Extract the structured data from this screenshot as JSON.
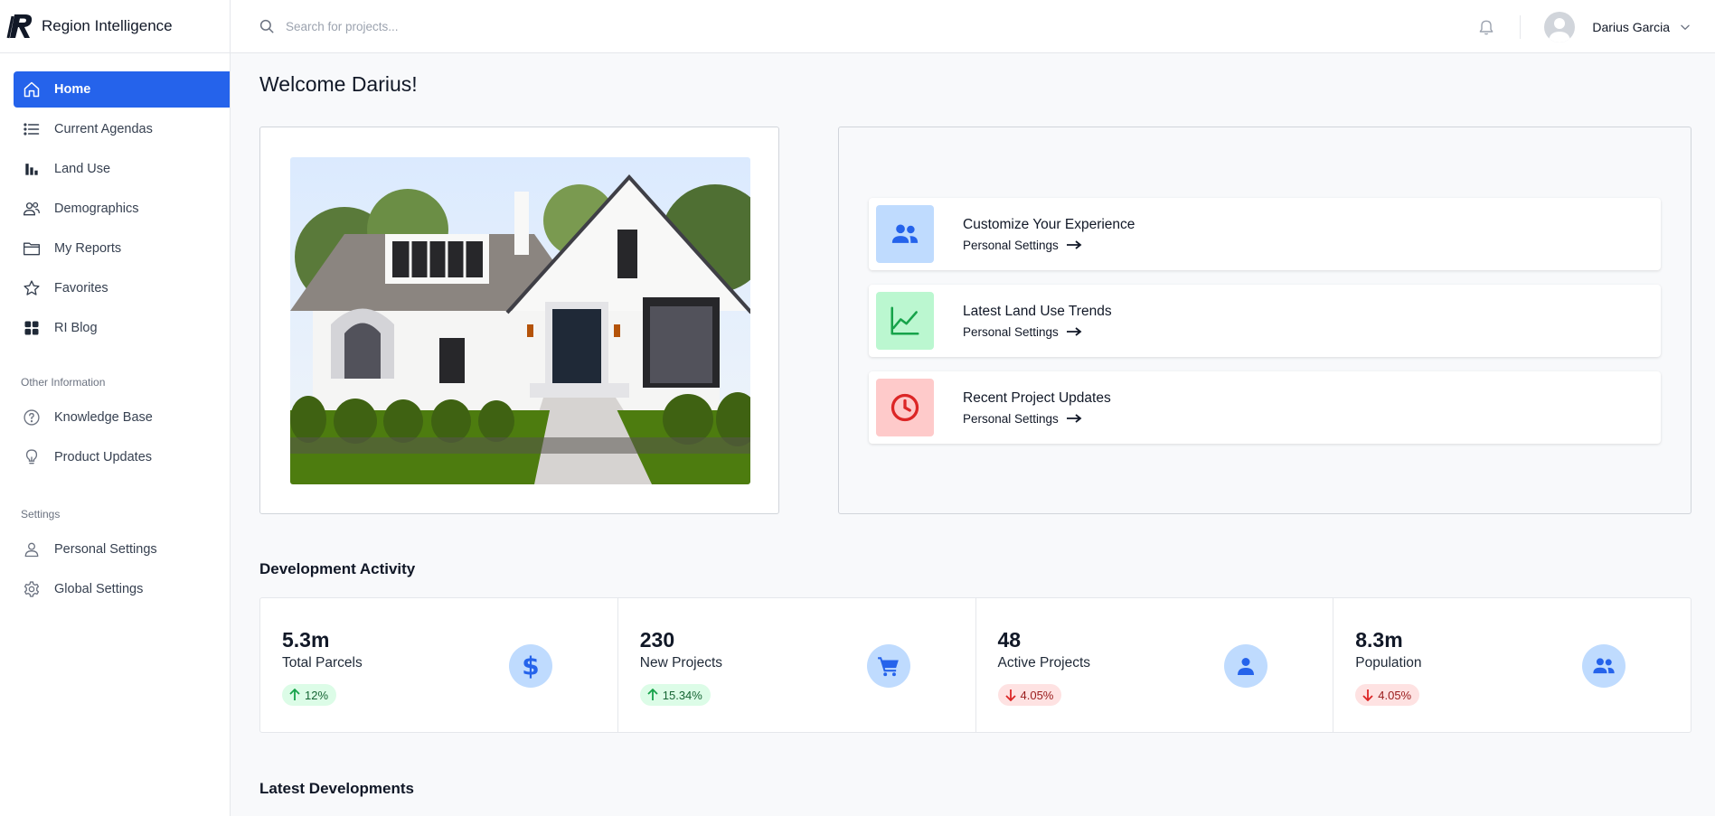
{
  "brand": {
    "name": "Region Intelligence"
  },
  "nav": {
    "items": [
      {
        "label": "Home",
        "icon": "home-icon",
        "active": true
      },
      {
        "label": "Current Agendas",
        "icon": "list-icon"
      },
      {
        "label": "Land Use",
        "icon": "bar-chart-icon"
      },
      {
        "label": "Demographics",
        "icon": "users-icon"
      },
      {
        "label": "My Reports",
        "icon": "folder-icon"
      },
      {
        "label": "Favorites",
        "icon": "star-icon"
      },
      {
        "label": "RI Blog",
        "icon": "grid-icon"
      }
    ],
    "other_label": "Other Information",
    "other_items": [
      {
        "label": "Knowledge Base",
        "icon": "help-circle-icon"
      },
      {
        "label": "Product Updates",
        "icon": "lightbulb-icon"
      }
    ],
    "settings_label": "Settings",
    "settings_items": [
      {
        "label": "Personal Settings",
        "icon": "user-icon"
      },
      {
        "label": "Global Settings",
        "icon": "gear-icon"
      }
    ]
  },
  "search": {
    "placeholder": "Search for projects..."
  },
  "user": {
    "name": "Darius Garcia"
  },
  "welcome": "Welcome Darius!",
  "actions": [
    {
      "title": "Customize Your Experience",
      "link": "Personal Settings",
      "icon": "users-icon",
      "bg": "#bfdbfe",
      "color": "#2563eb"
    },
    {
      "title": "Latest Land Use Trends",
      "link": "Personal Settings",
      "icon": "trend-chart-icon",
      "bg": "#bbf7d0",
      "color": "#16a34a"
    },
    {
      "title": "Recent Project Updates",
      "link": "Personal Settings",
      "icon": "clock-icon",
      "bg": "#fecaca",
      "color": "#dc2626"
    }
  ],
  "development_title": "Development Activity",
  "stats": [
    {
      "value": "5.3m",
      "label": "Total Parcels",
      "change": "12%",
      "direction": "up",
      "icon": "dollar-icon"
    },
    {
      "value": "230",
      "label": "New Projects",
      "change": "15.34%",
      "direction": "up",
      "icon": "cart-icon"
    },
    {
      "value": "48",
      "label": "Active Projects",
      "change": "4.05%",
      "direction": "down",
      "icon": "person-icon"
    },
    {
      "value": "8.3m",
      "label": "Population",
      "change": "4.05%",
      "direction": "down",
      "icon": "group-icon"
    }
  ],
  "latest_title": "Latest Developments",
  "colors": {
    "accent": "#2563eb",
    "up": "#16a34a",
    "down": "#dc2626"
  }
}
